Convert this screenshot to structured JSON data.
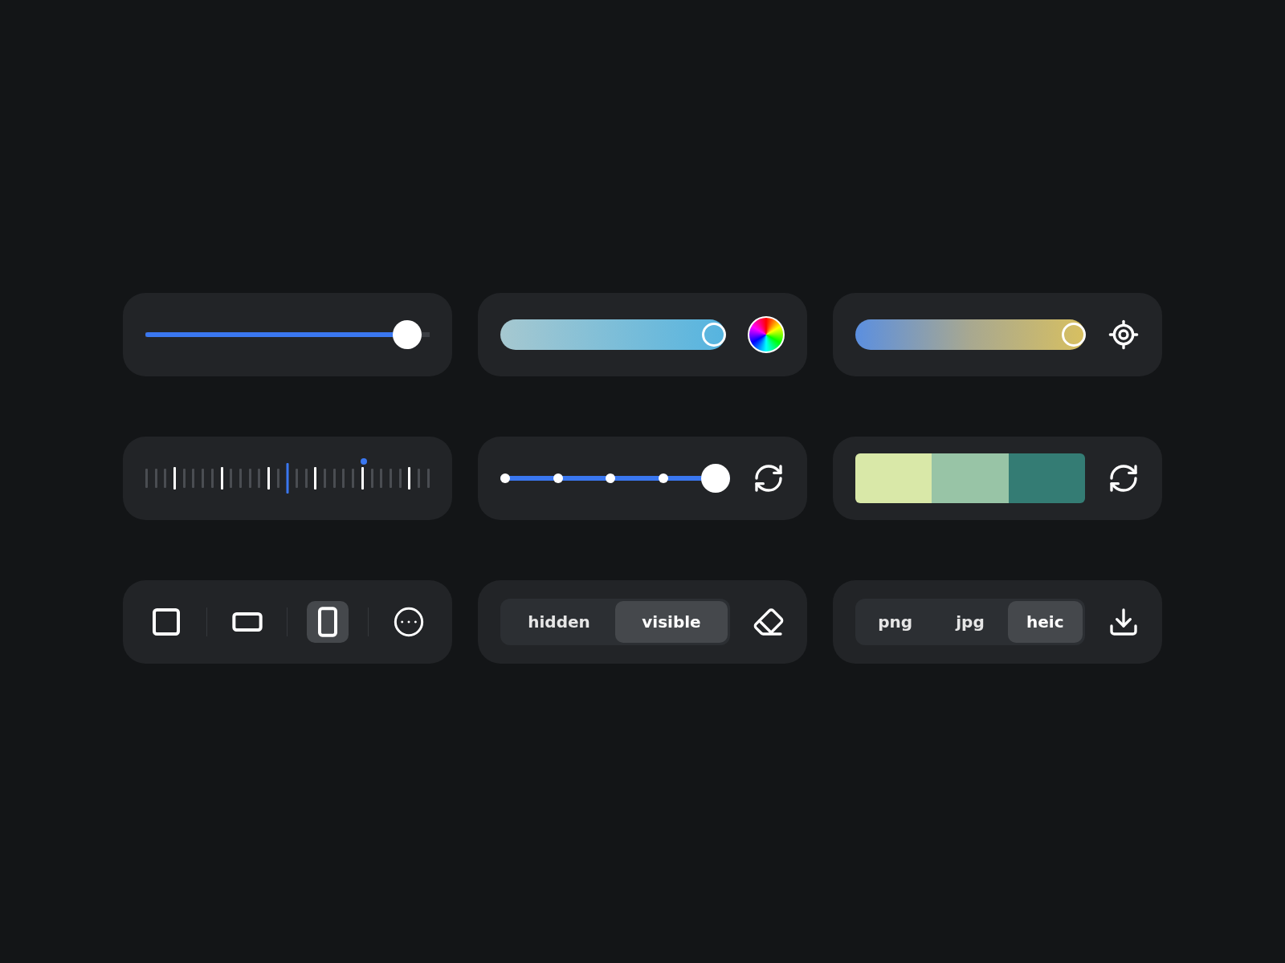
{
  "sliders": {
    "volume": {
      "level": 0.97
    },
    "hue": {
      "level": 0.95
    },
    "tone": {
      "level": 0.95
    }
  },
  "ruler": {
    "level": 0.5
  },
  "stepper": {
    "level": 1
  },
  "palette": {
    "swatches": [
      {
        "color": "#d9e8a8"
      },
      {
        "color": "#98c4a6"
      },
      {
        "color": "#347c74"
      }
    ]
  },
  "aspect": {
    "items": [
      {
        "kind": "square",
        "selected": false
      },
      {
        "kind": "landscape",
        "selected": false
      },
      {
        "kind": "portrait",
        "selected": true
      },
      {
        "kind": "more",
        "selected": false
      }
    ]
  },
  "visibility": {
    "options": [
      {
        "label": "hidden",
        "selected": false
      },
      {
        "label": "visible",
        "selected": true
      }
    ]
  },
  "format": {
    "options": [
      {
        "label": "png",
        "selected": false
      },
      {
        "label": "jpg",
        "selected": false
      },
      {
        "label": "heic",
        "selected": true
      }
    ]
  }
}
